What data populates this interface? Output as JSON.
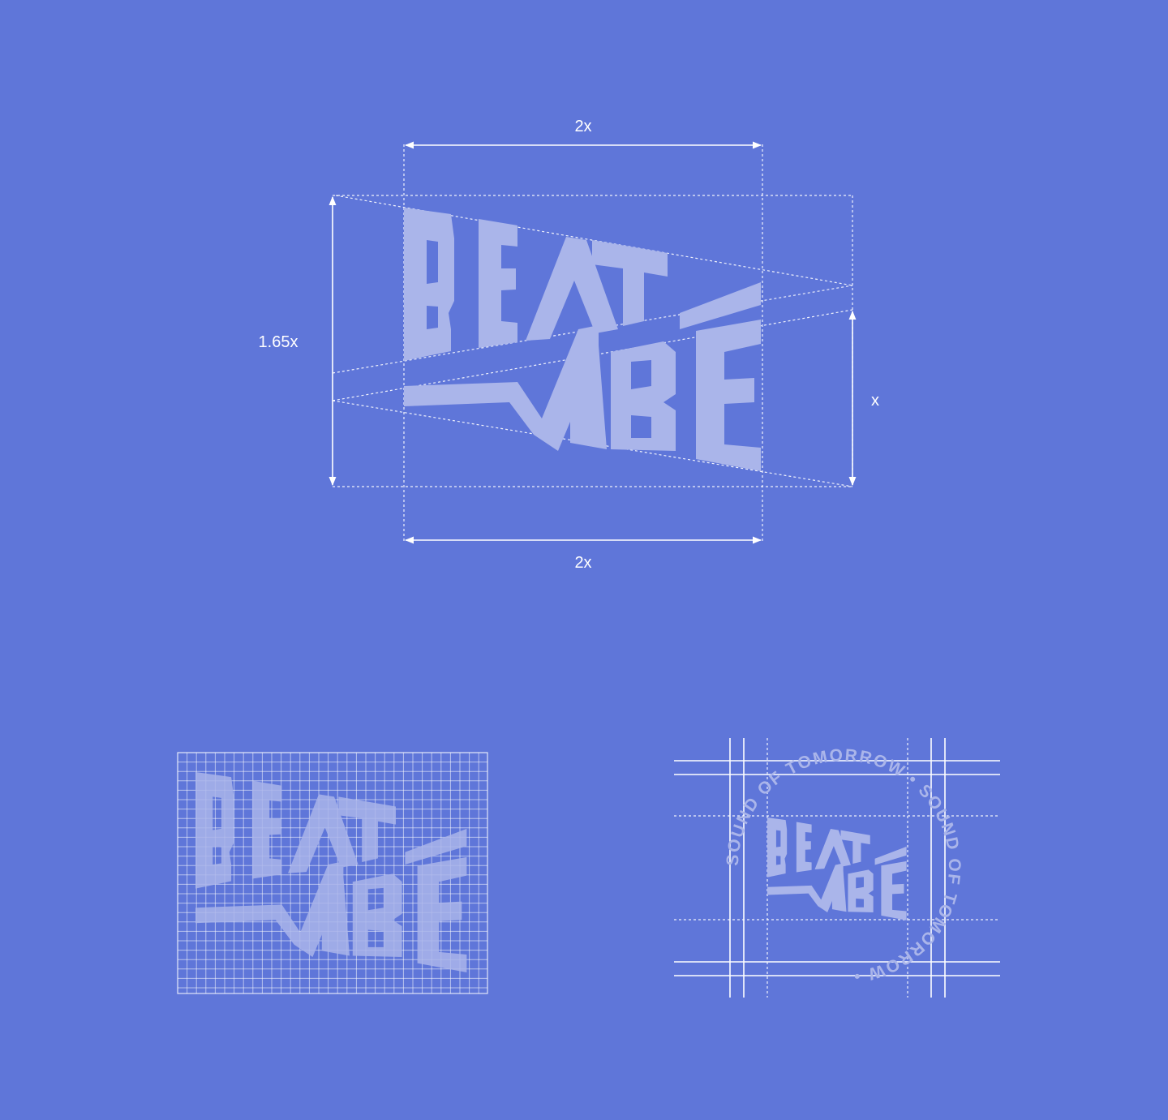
{
  "construction": {
    "top_width_label": "2x",
    "bottom_width_label": "2x",
    "height_label": "1.65x",
    "right_height_label": "x"
  },
  "badge": {
    "ring_text": "SOUND OF TOMORROW  •  SOUND OF TOMORROW  •  "
  },
  "colors": {
    "background": "#5f76d9",
    "logo_fill": "#aab5ea",
    "guide_lines": "#ffffff"
  },
  "icons": {
    "logo": "beat-vibe-wordmark-logo",
    "arrow": "dimension-arrow-icon"
  }
}
